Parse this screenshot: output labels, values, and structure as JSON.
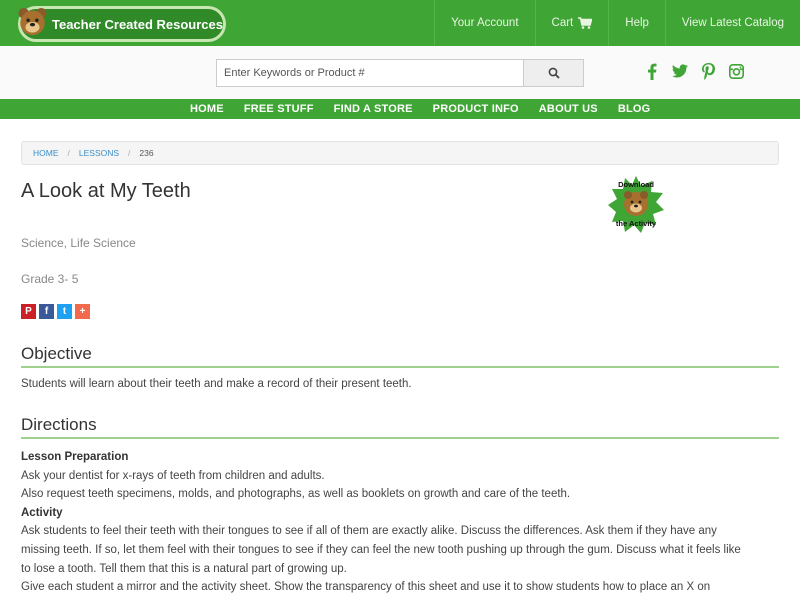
{
  "header": {
    "logo_text": "Teacher Created Resources",
    "nav": [
      {
        "label": "Your Account"
      },
      {
        "label": "Cart"
      },
      {
        "label": "Help"
      },
      {
        "label": "View Latest Catalog"
      }
    ]
  },
  "search": {
    "placeholder": "Enter Keywords or Product #"
  },
  "social_icons": [
    "facebook-icon",
    "twitter-icon",
    "pinterest-icon",
    "instagram-icon"
  ],
  "main_nav": [
    "HOME",
    "FREE STUFF",
    "FIND A STORE",
    "PRODUCT INFO",
    "ABOUT US",
    "BLOG"
  ],
  "breadcrumb": {
    "home": "HOME",
    "lessons": "LESSONS",
    "current": "236"
  },
  "lesson": {
    "title": "A Look at My Teeth",
    "subject": "Science, Life Science",
    "grade": "Grade 3- 5",
    "download_line1": "Download",
    "download_line2": "the Activity"
  },
  "share": {
    "pinterest": "P",
    "facebook": "f",
    "twitter": "t",
    "plus": "+"
  },
  "objective": {
    "heading": "Objective",
    "text": "Students will learn about their teeth and make a record of their present teeth."
  },
  "directions": {
    "heading": "Directions",
    "prep_heading": "Lesson Preparation",
    "prep_line1": "Ask your dentist for x-rays of teeth from children and adults.",
    "prep_line2": "Also request teeth specimens, molds, and photographs, as well as booklets on growth and care of the teeth.",
    "activity_heading": "Activity",
    "activity_p1_l1": "Ask students to feel their teeth with their tongues to see if all of them are exactly alike. Discuss the differences. Ask them if they have any",
    "activity_p1_l2": "missing teeth. If so, let them feel with their tongues to see if they can feel the new tooth pushing up through the gum. Discuss what it feels like",
    "activity_p1_l3": "to lose a tooth. Tell them that this is a natural part of growing up.",
    "activity_p2_l1": "Give each student a mirror and the activity sheet. Show the transparency of this sheet and use it to show students how to place an X on"
  },
  "colors": {
    "brand_green": "#3fa535",
    "link_blue": "#3a8fc7",
    "rule_green": "#9fd08e"
  }
}
